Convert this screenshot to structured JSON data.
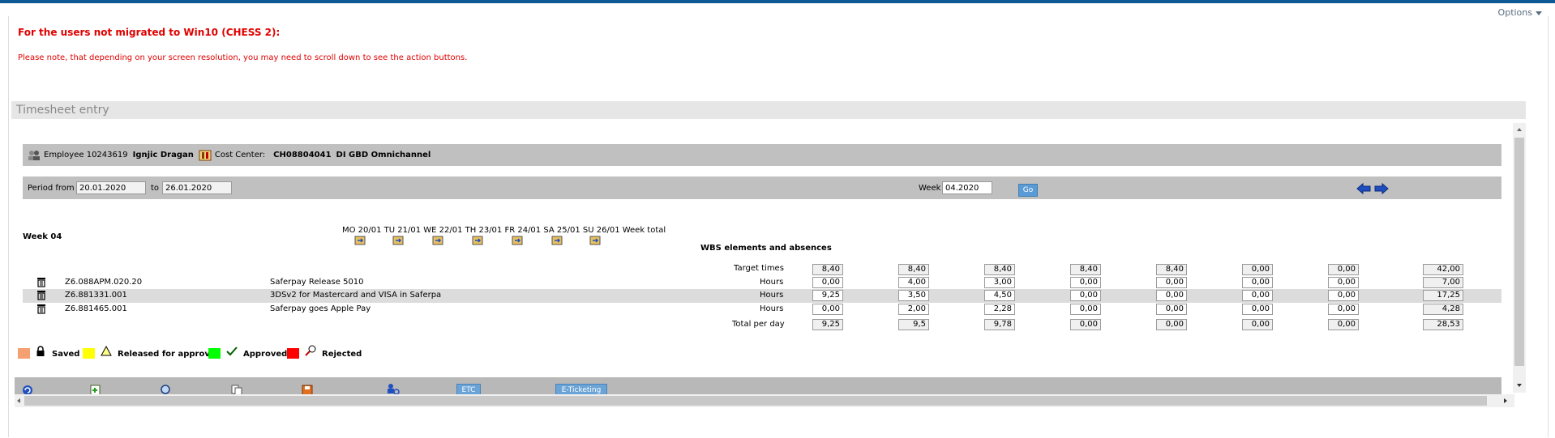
{
  "header": {
    "options_label": "Options"
  },
  "notice": {
    "title": "For the users not migrated to Win10 (CHESS 2):",
    "text": "Please note, that depending on your screen resolution, you may need to scroll down to see the action buttons."
  },
  "section": {
    "title": "Timesheet entry"
  },
  "employee": {
    "prefix": "Employee 10243619",
    "name": "Ignjic Dragan",
    "cost_center_label": "Cost Center:",
    "cost_center_value": "CH08804041",
    "cost_center_name": "DI GBD Omnichannel"
  },
  "period": {
    "from_label": "Period from",
    "from_value": "20.01.2020",
    "to_label": "to",
    "to_value": "26.01.2020",
    "week_label": "Week",
    "week_value": "04.2020",
    "go_label": "Go"
  },
  "grid": {
    "week_title": "Week 04",
    "day_headers": "MO 20/01 TU 21/01 WE 22/01 TH 23/01 FR 24/01 SA 25/01 SU 26/01 Week total",
    "wbs_label": "WBS elements and absences",
    "target_label": "Target times",
    "target_values": [
      "8,40",
      "8,40",
      "8,40",
      "8,40",
      "8,40",
      "0,00",
      "0,00",
      "42,00"
    ],
    "rows": [
      {
        "code": "Z6.088APM.020.20",
        "desc": "Saferpay Release 5010",
        "unit": "Hours",
        "values": [
          "0,00",
          "4,00",
          "3,00",
          "0,00",
          "0,00",
          "0,00",
          "0,00",
          "7,00"
        ]
      },
      {
        "code": "Z6.881331.001",
        "desc": "3DSv2 for Mastercard and VISA in Saferpa",
        "unit": "Hours",
        "values": [
          "9,25",
          "3,50",
          "4,50",
          "0,00",
          "0,00",
          "0,00",
          "0,00",
          "17,25"
        ]
      },
      {
        "code": "Z6.881465.001",
        "desc": "Saferpay goes Apple Pay",
        "unit": "Hours",
        "values": [
          "0,00",
          "2,00",
          "2,28",
          "0,00",
          "0,00",
          "0,00",
          "0,00",
          "4,28"
        ]
      }
    ],
    "total_label": "Total per day",
    "total_values": [
      "9,25",
      "9,5",
      "9,78",
      "0,00",
      "0,00",
      "0,00",
      "0,00",
      "28,53"
    ]
  },
  "legend": {
    "saved": "Saved",
    "released": "Released for approval",
    "approved": "Approved",
    "rejected": "Rejected",
    "colors": {
      "saved": "#f4a070",
      "released": "#ffff00",
      "approved": "#00ff00",
      "rejected": "#ff0000"
    }
  },
  "toolbar": {
    "etc_label": "ETC",
    "eticketing_label": "E-Ticketing"
  }
}
